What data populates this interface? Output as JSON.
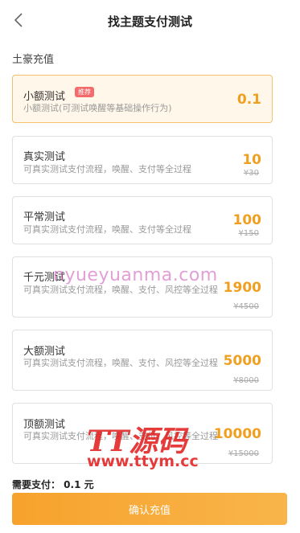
{
  "header": {
    "title": "找主题支付测试",
    "back_icon": "chevron-left-icon"
  },
  "section_title": "土豪充值",
  "plans": [
    {
      "name": "小额测试",
      "badge": "推荐",
      "desc": "小额测试(可测试唤醒等基础操作行为)",
      "price": "0.1",
      "original": ""
    },
    {
      "name": "真实测试",
      "desc": "可真实测试支付流程，唤醒、支付等全过程",
      "price": "10",
      "original": "¥30"
    },
    {
      "name": "平常测试",
      "desc": "可真实测试支付流程，唤醒、支付等全过程",
      "price": "100",
      "original": "¥150"
    },
    {
      "name": "千元测试",
      "desc": "可真实测试支付流程，唤醒、支付、风控等全过程",
      "price": "1900",
      "original": "¥4500"
    },
    {
      "name": "大额测试",
      "desc": "可真实测试支付流程，唤醒、支付、风控等全过程",
      "price": "5000",
      "original": "¥8000"
    },
    {
      "name": "顶额测试",
      "desc": "可真实测试支付流程，唤醒、支付、风控等全过程",
      "price": "10000",
      "original": "¥15000"
    }
  ],
  "selected_plan": "小额测试",
  "watermarks": {
    "site": "nyueyuanma.com",
    "logo": "TT源码",
    "url": "www.ttym.cc"
  },
  "pay_summary": "需要支付：  0.1 元",
  "confirm_label": "确认充值",
  "colors": {
    "accent": "#f0a020",
    "badge": "#f46b6b",
    "selected_bg": "#fff7ea",
    "button": "#f7a22d"
  }
}
